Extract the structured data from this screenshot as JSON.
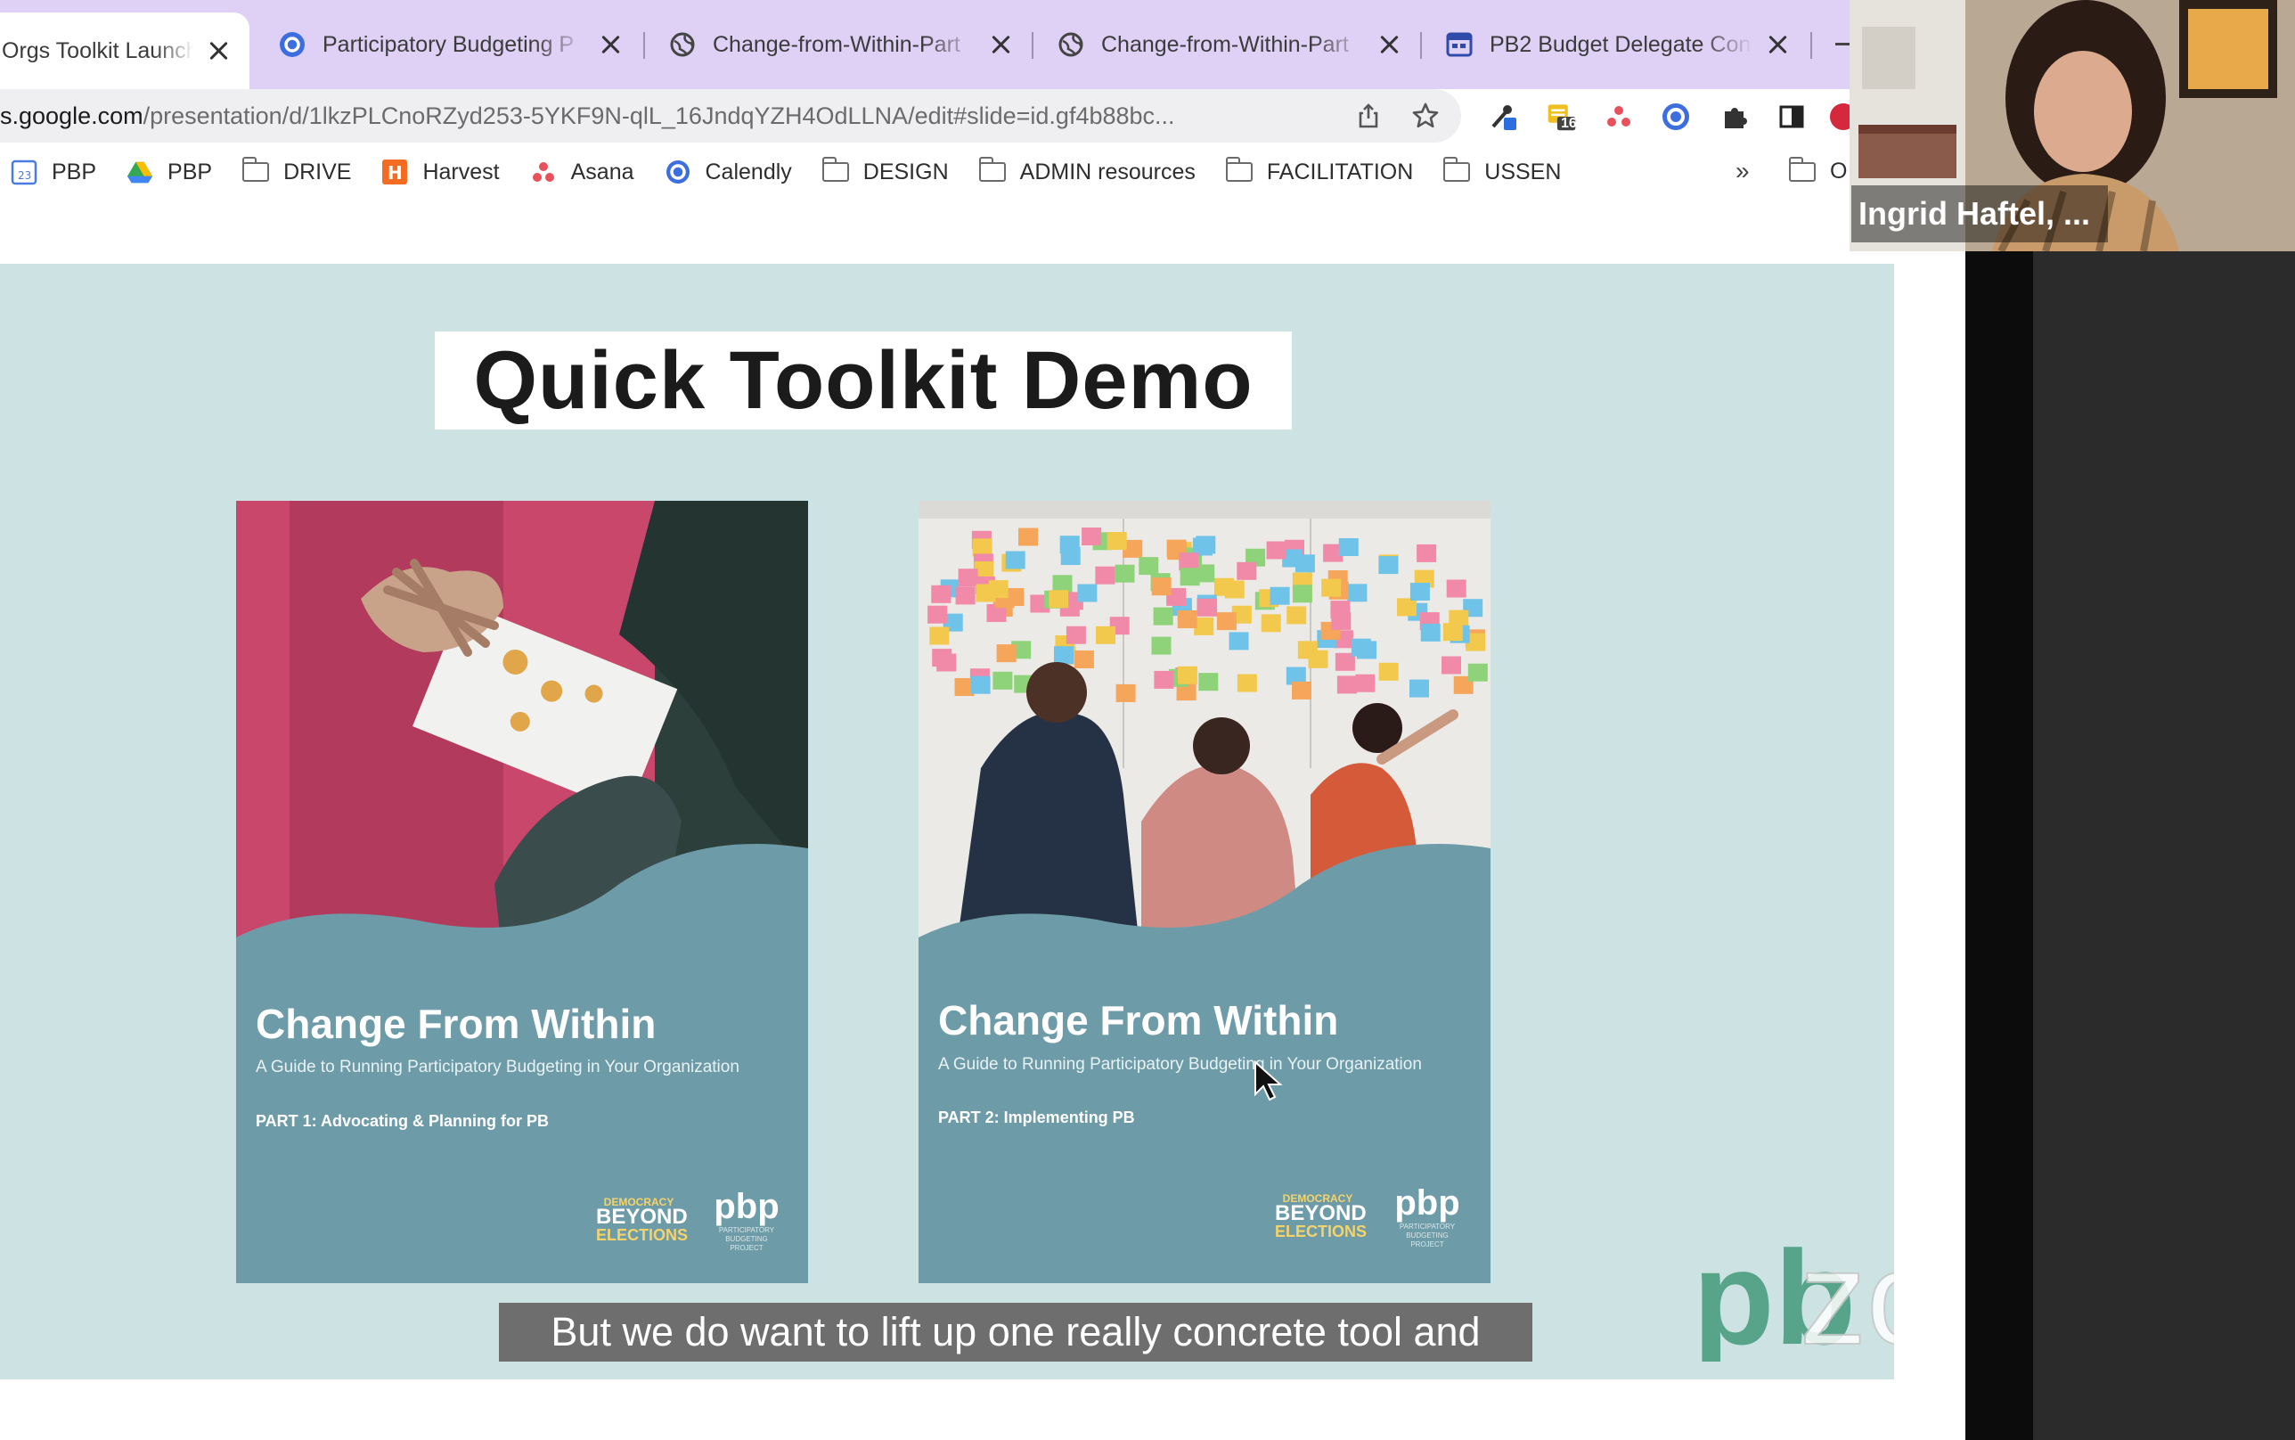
{
  "browser": {
    "tabs": [
      {
        "title": "Orgs Toolkit Launch",
        "active": true,
        "favicon": "none"
      },
      {
        "title": "Participatory Budgeting P",
        "active": false,
        "favicon": "calendly-icon"
      },
      {
        "title": "Change-from-Within-Part",
        "active": false,
        "favicon": "globe-icon"
      },
      {
        "title": "Change-from-Within-Part",
        "active": false,
        "favicon": "globe-icon"
      },
      {
        "title": "PB2 Budget Delegate Con",
        "active": false,
        "favicon": "calendar-icon"
      }
    ],
    "url_host": "s.google.com",
    "url_path": "/presentation/d/1lkzPLCnoRZyd253-5YKF9N-qlL_16JndqYZH4OdLLNA/edit#slide=id.gf4b88bc...",
    "extension_badge": "16",
    "bookmarks": [
      {
        "label": "PBP",
        "icon": "calendar-icon"
      },
      {
        "label": "PBP",
        "icon": "drive-icon"
      },
      {
        "label": "DRIVE",
        "icon": "folder-icon"
      },
      {
        "label": "Harvest",
        "icon": "harvest-icon"
      },
      {
        "label": "Asana",
        "icon": "asana-icon"
      },
      {
        "label": "Calendly",
        "icon": "calendly-icon"
      },
      {
        "label": "DESIGN",
        "icon": "folder-icon"
      },
      {
        "label": "ADMIN resources",
        "icon": "folder-icon"
      },
      {
        "label": "FACILITATION",
        "icon": "folder-icon"
      },
      {
        "label": "USSEN",
        "icon": "folder-icon"
      }
    ],
    "bookmarks_overflow": "»",
    "bookmark_trailing": "O"
  },
  "slide": {
    "title": "Quick Toolkit Demo",
    "covers": [
      {
        "title": "Change From Within",
        "subtitle": "A Guide to Running Participatory Budgeting in Your Organization",
        "part": "PART 1: Advocating & Planning for PB"
      },
      {
        "title": "Change From Within",
        "subtitle": "A Guide to Running Participatory Budgeting in Your Organization",
        "part": "PART 2: Implementing PB"
      }
    ],
    "logos": {
      "dbe_top": "DEMOCRACY",
      "dbe_mid": "BEYOND",
      "dbe_bottom": "ELECTIONS",
      "pbp": "pbp",
      "pbp_tag": "PARTICIPATORY BUDGETING PROJECT"
    }
  },
  "caption": "But we do want to lift up one really concrete tool and",
  "video": {
    "participant_name": "Ingrid Haftel, ..."
  },
  "watermark": {
    "pbp": "pb",
    "zoom": "zoom"
  },
  "colors": {
    "tab_strip": "#dfd0f5",
    "slide_bg": "#cde2e2",
    "cover_teal": "#6d9ca8"
  }
}
